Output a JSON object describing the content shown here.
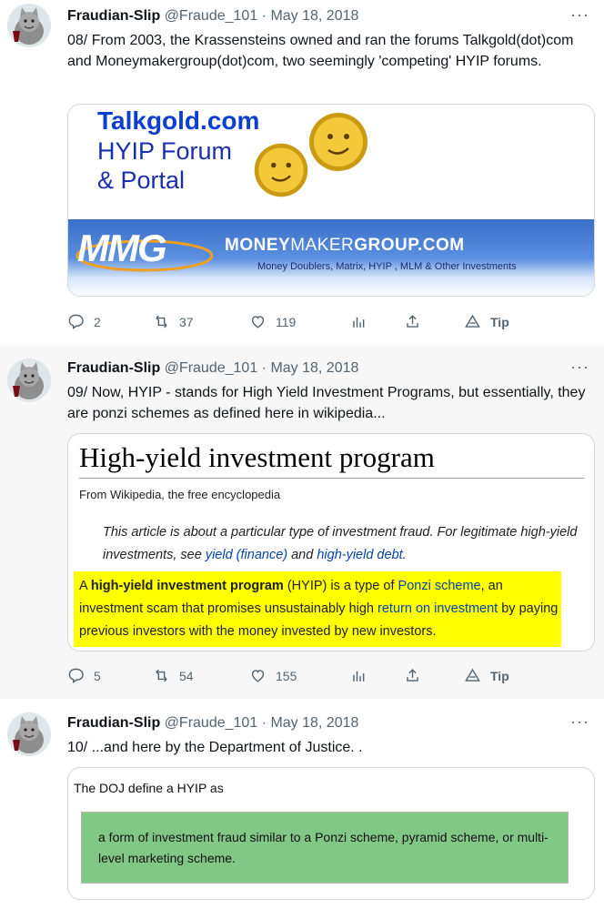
{
  "tweets": [
    {
      "name": "Fraudian-Slip",
      "meta": "@Fraude_101 · May 18, 2018",
      "more": "···",
      "text": "08/ From 2003, the Krassensteins owned and ran the forums Talkgold(dot)com and Moneymakergroup(dot)com, two seemingly 'competing' HYIP forums.",
      "actions": {
        "replies": "2",
        "retweets": "37",
        "likes": "119",
        "tip": "Tip"
      }
    },
    {
      "name": "Fraudian-Slip",
      "meta": "@Fraude_101 · May 18, 2018",
      "more": "···",
      "text": "09/ Now, HYIP - stands for High Yield Investment Programs, but essentially, they are ponzi schemes as defined here in wikipedia...",
      "actions": {
        "replies": "5",
        "retweets": "54",
        "likes": "155",
        "tip": "Tip"
      }
    },
    {
      "name": "Fraudian-Slip",
      "meta": "@Fraude_101 · May 18, 2018",
      "more": "···",
      "text": "10/ ...and here by the Department of Justice. ."
    }
  ],
  "talkgold_card": {
    "title": "Talkgold.com",
    "sub1": "HYIP Forum",
    "sub2": "& Portal",
    "mmg_logo": "MMG",
    "brand_a": "MONEY",
    "brand_b": "MAKER",
    "brand_c": "GROUP.COM",
    "tagline": "Money Doublers, Matrix, HYIP , MLM & Other Investments"
  },
  "wiki_card": {
    "title": "High-yield investment program",
    "from": "From Wikipedia, the free encyclopedia",
    "hat_1": "This article is about a particular type of investment fraud. For legitimate high-yield investments, see ",
    "hat_link1": "yield (finance)",
    "hat_and": " and ",
    "hat_link2": "high-yield debt",
    "hat_end": ".",
    "body_a": "A ",
    "body_bold": "high-yield investment program",
    "body_b": " (HYIP) is a type of ",
    "body_link1": "Ponzi scheme",
    "body_c": ", an investment scam that promises unsustainably high ",
    "body_link2": "return on investment",
    "body_d": " by paying previous investors with the money invested by new investors."
  },
  "doj_card": {
    "label": "The DOJ define a HYIP as",
    "quote": "a form of investment fraud similar to a Ponzi scheme, pyramid scheme, or multi-level marketing scheme."
  },
  "colors": {
    "link": "#0645ad",
    "highlight": "#ffff00",
    "doj_green": "#82c885",
    "muted": "#536471"
  }
}
